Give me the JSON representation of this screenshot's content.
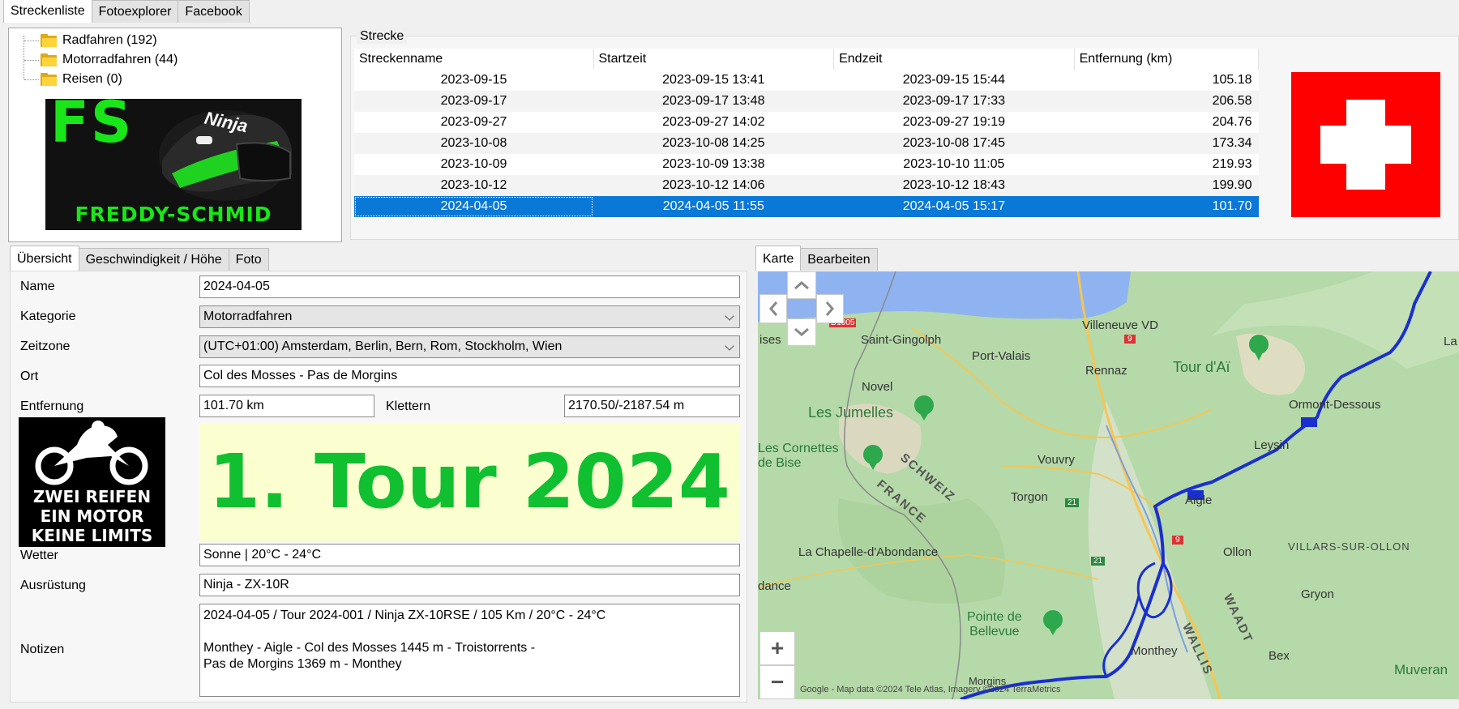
{
  "top_tabs": [
    "Streckenliste",
    "Fotoexplorer",
    "Facebook"
  ],
  "tree": [
    {
      "label": "Radfahren (192)"
    },
    {
      "label": "Motorradfahren (44)"
    },
    {
      "label": "Reisen (0)"
    }
  ],
  "logo": {
    "initials": "FS",
    "name": "FREDDY-SCHMID",
    "helmet_text": "Ninja"
  },
  "strecke": {
    "group_label": "Strecke",
    "columns": [
      "Streckenname",
      "Startzeit",
      "Endzeit",
      "Entfernung (km)"
    ],
    "rows": [
      {
        "name": "2023-09-15",
        "start": "2023-09-15 13:41",
        "end": "2023-09-15 15:44",
        "dist": "105.18"
      },
      {
        "name": "2023-09-17",
        "start": "2023-09-17 13:48",
        "end": "2023-09-17 17:33",
        "dist": "206.58"
      },
      {
        "name": "2023-09-27",
        "start": "2023-09-27 14:02",
        "end": "2023-09-27 19:19",
        "dist": "204.76"
      },
      {
        "name": "2023-10-08",
        "start": "2023-10-08 14:25",
        "end": "2023-10-08 17:45",
        "dist": "173.34"
      },
      {
        "name": "2023-10-09",
        "start": "2023-10-09 13:38",
        "end": "2023-10-10 11:05",
        "dist": "219.93"
      },
      {
        "name": "2023-10-12",
        "start": "2023-10-12 14:06",
        "end": "2023-10-12 18:43",
        "dist": "199.90"
      },
      {
        "name": "2024-04-05",
        "start": "2024-04-05 11:55",
        "end": "2024-04-05 15:17",
        "dist": "101.70"
      }
    ],
    "selected_index": 6
  },
  "detail_tabs": [
    "Übersicht",
    "Geschwindigkeit / Höhe",
    "Foto"
  ],
  "form": {
    "name_label": "Name",
    "name_value": "2024-04-05",
    "kategorie_label": "Kategorie",
    "kategorie_value": "Motorradfahren",
    "zeitzone_label": "Zeitzone",
    "zeitzone_value": "(UTC+01:00) Amsterdam, Berlin, Bern, Rom, Stockholm, Wien",
    "ort_label": "Ort",
    "ort_value": "Col des Mosses - Pas de Morgins",
    "entfernung_label": "Entfernung",
    "entfernung_value": "101.70 km",
    "klettern_label": "Klettern",
    "klettern_value": "2170.50/-2187.54 m",
    "banner": "1. Tour 2024",
    "sticker_lines": [
      "ZWEI REIFEN",
      "EIN MOTOR",
      "KEINE LIMITS"
    ],
    "wetter_label": "Wetter",
    "wetter_value": "Sonne | 20°C - 24°C",
    "ausruestung_label": "Ausrüstung",
    "ausruestung_value": "Ninja - ZX-10R",
    "notizen_label": "Notizen",
    "notizen_value": "2024-04-05 / Tour 2024-001 / Ninja ZX-10RSE / 105 Km / 20°C - 24°C\n\nMonthey - Aigle - Col des Mosses 1445 m - Troistorrents -\nPas de Morgins 1369 m - Monthey"
  },
  "map_tabs": [
    "Karte",
    "Bearbeiten"
  ],
  "map": {
    "labels": {
      "saint_gingolph": "Saint-Gingolph",
      "villeneuve": "Villeneuve VD",
      "port_valais": "Port-Valais",
      "rennaz": "Rennaz",
      "tour_dai": "Tour d'Aï",
      "ormont": "Ormont-Dessous",
      "novel": "Novel",
      "jumelles": "Les Jumelles",
      "cornettes": "Les Cornettes\nde Bise",
      "leysin": "Leysin",
      "vouvry": "Vouvry",
      "schweiz": "SCHWEIZ",
      "france": "FRANCE",
      "torgon": "Torgon",
      "aigle": "Aigle",
      "chapelle": "La Chapelle-d'Abondance",
      "ollon": "Ollon",
      "villars": "VILLARS-SUR-OLLON",
      "dance": "dance",
      "gryon": "Gryon",
      "pointe": "Pointe de\nBellevue",
      "waadt": "WAADT",
      "monthey": "Monthey",
      "wallis": "WALLIS",
      "bex": "Bex",
      "muveran": "Muveran",
      "ises": "ises",
      "morgins": "Morgins",
      "la": "La",
      "road_d1005": "D1005",
      "road_9a": "9",
      "road_9b": "9",
      "road_21a": "21",
      "road_21b": "21"
    },
    "attribution": "Google - Map data ©2024 Tele Atlas, Imagery ©2024 TerraMetrics",
    "zoom_in": "+",
    "zoom_out": "−",
    "colors": {
      "water": "#8fb3f0",
      "land": "#b8dcb0",
      "track": "#1a2fd0"
    }
  },
  "flag": {
    "color": "#ff0000",
    "cross": "#ffffff"
  }
}
